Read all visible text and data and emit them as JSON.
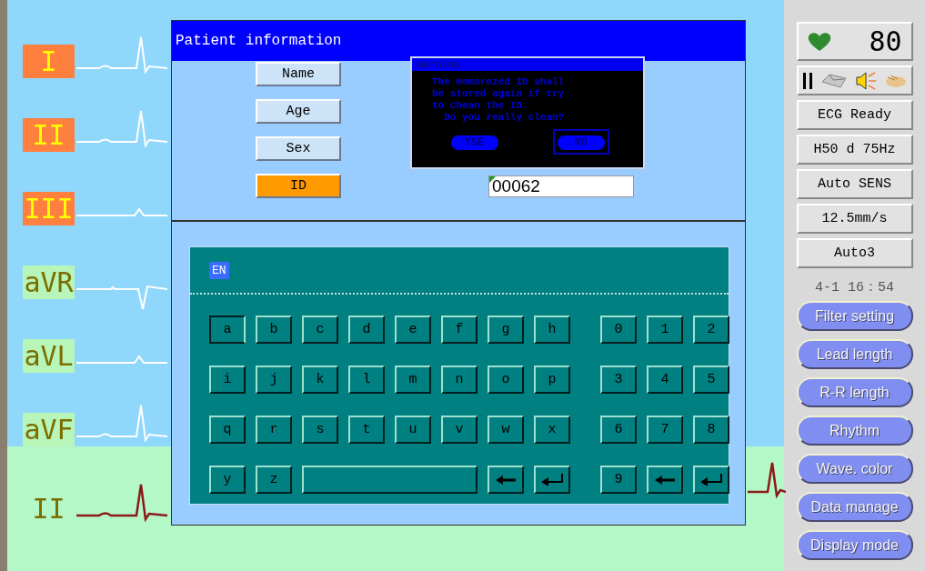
{
  "leads": [
    {
      "label": "I",
      "color": "#ff7f3f",
      "kind": "upright"
    },
    {
      "label": "II",
      "color": "#ff7f3f",
      "kind": "upright"
    },
    {
      "label": "III",
      "color": "#ff7f3f",
      "kind": "small"
    },
    {
      "label": "aVR",
      "color": "#b8f5b8",
      "kind": "inverted"
    },
    {
      "label": "aVL",
      "color": "#b8f5b8",
      "kind": "small"
    },
    {
      "label": "aVF",
      "color": "#b8f5b8",
      "kind": "upright"
    }
  ],
  "rhythm_strip": {
    "label": "II"
  },
  "dialog": {
    "title": "Patient information",
    "fields": [
      {
        "label": "Name",
        "selected": false
      },
      {
        "label": "Age",
        "selected": false
      },
      {
        "label": "Sex",
        "selected": false
      },
      {
        "label": "ID",
        "selected": true,
        "value": "00062"
      }
    ],
    "warning": {
      "title": "Warning",
      "message": "The memorezed ID shall\nbe stored again if try\nto chean the ID.\n  Do you really clean?",
      "buttons": [
        {
          "label": "YSE",
          "selected": false
        },
        {
          "label": "NO",
          "selected": true
        }
      ]
    },
    "keyboard": {
      "language": "EN",
      "rows": [
        {
          "letters": [
            {
              "kind": "char",
              "label": "a",
              "selected": true
            },
            {
              "kind": "char",
              "label": "b",
              "selected": false
            },
            {
              "kind": "char",
              "label": "c",
              "selected": false
            },
            {
              "kind": "char",
              "label": "d",
              "selected": false
            },
            {
              "kind": "char",
              "label": "e",
              "selected": false
            },
            {
              "kind": "char",
              "label": "f",
              "selected": false
            },
            {
              "kind": "char",
              "label": "g",
              "selected": false
            },
            {
              "kind": "char",
              "label": "h",
              "selected": false
            }
          ],
          "digits": [
            {
              "kind": "char",
              "label": "0",
              "selected": false
            },
            {
              "kind": "char",
              "label": "1",
              "selected": false
            },
            {
              "kind": "char",
              "label": "2",
              "selected": false
            }
          ]
        },
        {
          "letters": [
            {
              "kind": "char",
              "label": "i",
              "selected": false
            },
            {
              "kind": "char",
              "label": "j",
              "selected": false
            },
            {
              "kind": "char",
              "label": "k",
              "selected": false
            },
            {
              "kind": "char",
              "label": "l",
              "selected": false
            },
            {
              "kind": "char",
              "label": "m",
              "selected": false
            },
            {
              "kind": "char",
              "label": "n",
              "selected": false
            },
            {
              "kind": "char",
              "label": "o",
              "selected": false
            },
            {
              "kind": "char",
              "label": "p",
              "selected": false
            }
          ],
          "digits": [
            {
              "kind": "char",
              "label": "3",
              "selected": false
            },
            {
              "kind": "char",
              "label": "4",
              "selected": false
            },
            {
              "kind": "char",
              "label": "5",
              "selected": false
            }
          ]
        },
        {
          "letters": [
            {
              "kind": "char",
              "label": "q",
              "selected": false
            },
            {
              "kind": "char",
              "label": "r",
              "selected": false
            },
            {
              "kind": "char",
              "label": "s",
              "selected": false
            },
            {
              "kind": "char",
              "label": "t",
              "selected": false
            },
            {
              "kind": "char",
              "label": "u",
              "selected": false
            },
            {
              "kind": "char",
              "label": "v",
              "selected": false
            },
            {
              "kind": "char",
              "label": "w",
              "selected": false
            },
            {
              "kind": "char",
              "label": "x",
              "selected": false
            }
          ],
          "digits": [
            {
              "kind": "char",
              "label": "6",
              "selected": false
            },
            {
              "kind": "char",
              "label": "7",
              "selected": false
            },
            {
              "kind": "char",
              "label": "8",
              "selected": false
            }
          ]
        },
        {
          "letters": [
            {
              "kind": "char",
              "label": "y",
              "selected": false
            },
            {
              "kind": "char",
              "label": "z",
              "selected": false
            },
            {
              "kind": "space",
              "selected": false
            },
            {
              "kind": "backspace",
              "selected": false
            },
            {
              "kind": "enter",
              "selected": false
            }
          ],
          "digits": [
            {
              "kind": "char",
              "label": "9",
              "selected": false
            },
            {
              "kind": "backspace",
              "selected": false
            },
            {
              "kind": "enter",
              "selected": false
            }
          ]
        }
      ]
    }
  },
  "side_panel": {
    "heart_rate": "80",
    "status_items": [
      "ECG Ready",
      "H50 d 75Hz",
      "Auto SENS",
      "12.5mm/s",
      "Auto3"
    ],
    "datetime": "4-1 16：54",
    "menu": [
      "Filter setting",
      "Lead length",
      "R-R  length",
      "Rhythm",
      "Wave. color",
      "Data manage",
      "Display mode"
    ]
  }
}
